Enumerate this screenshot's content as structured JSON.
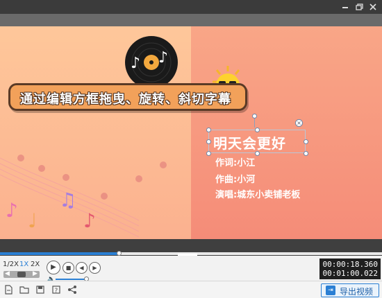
{
  "window": {
    "controls": [
      "minimize-icon",
      "restore-icon",
      "close-icon"
    ]
  },
  "stage": {
    "banner_text": "通过编辑方框拖曳、旋转、斜切字幕",
    "song_title": "明天会更好",
    "credits": [
      "作词:小江",
      "作曲:小河",
      "演唱:城东小卖铺老板"
    ]
  },
  "player": {
    "speeds": [
      "1/2X",
      "1X",
      "2X"
    ],
    "active_speed": "1X",
    "progress": 0.31,
    "volume": 0.85,
    "current_time": "00:00:18.360",
    "total_time": "00:01:00.022"
  },
  "toolbar": {
    "export_label": "导出视频",
    "icons": [
      "new-file-icon",
      "open-folder-icon",
      "save-icon",
      "help-icon",
      "share-icon"
    ]
  },
  "colors": {
    "accent": "#2a7fd4",
    "banner": "#f2a15a"
  }
}
